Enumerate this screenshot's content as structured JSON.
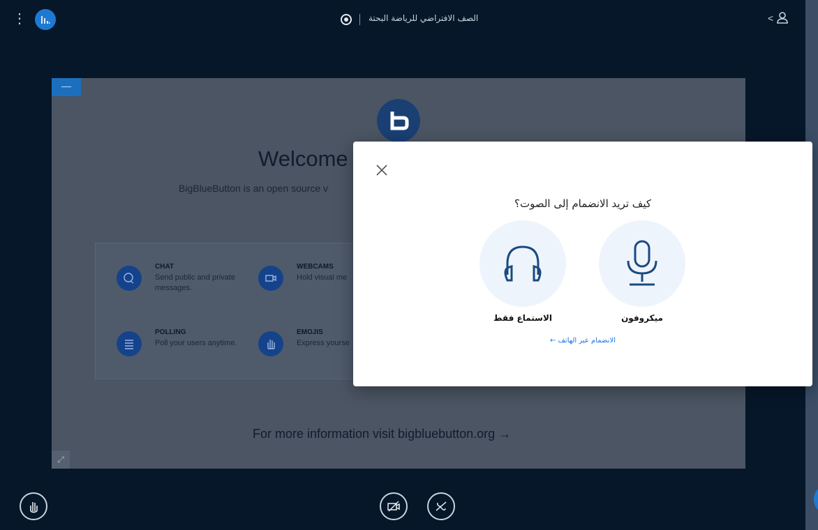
{
  "topbar": {
    "menu_glyph": "⋮",
    "meeting_title": "الصف الافتراضي للرياضة البحتة",
    "users_chevron": "<"
  },
  "presentation": {
    "minimize_glyph": "—",
    "welcome_title": "Welcome",
    "welcome_desc": "BigBlueButton is an open source v",
    "features": [
      {
        "title": "CHAT",
        "desc": "Send public and private messages."
      },
      {
        "title": "WEBCAMS",
        "desc": "Hold visual me"
      },
      {
        "title": "POLLING",
        "desc": "Poll your users anytime."
      },
      {
        "title": "EMOJIS",
        "desc": "Express yourse"
      }
    ],
    "more_info": "For more information visit bigbluebutton.org →",
    "fullscreen_glyph": "⤢"
  },
  "modal": {
    "close_glyph": "✕",
    "title": "كيف تريد الانضمام إلى الصوت؟",
    "options": {
      "microphone": "ميكروفون",
      "listen_only": "الاستماع فقط"
    },
    "phone_link": "الانضمام عبر الهاتف ←"
  },
  "colors": {
    "background": "#06172a",
    "accent": "#1e7ad1",
    "modal_bg": "#ffffff",
    "option_bg": "#eef4fb",
    "icon_stroke": "#1a4a80",
    "link": "#1a73e8"
  },
  "icons": [
    "menu-dots-icon",
    "bbb-logo-icon",
    "recording-icon",
    "user-icon",
    "headphones-icon",
    "microphone-icon",
    "raise-hand-icon",
    "camera-off-icon",
    "mic-off-icon",
    "close-icon"
  ]
}
